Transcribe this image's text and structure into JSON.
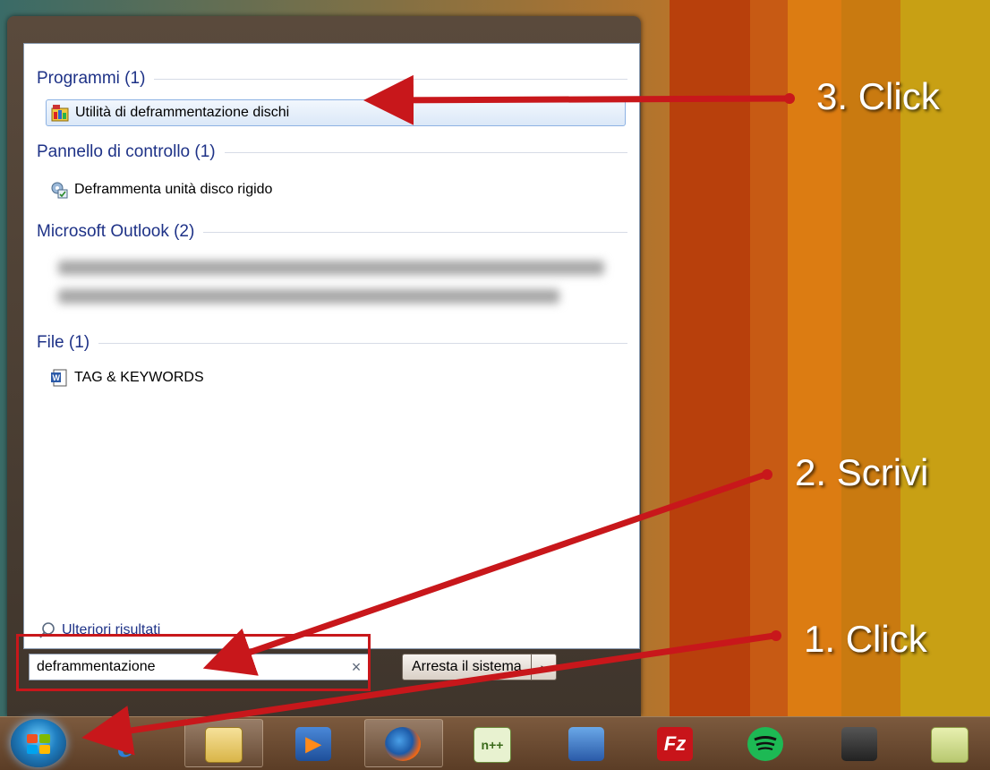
{
  "start_menu": {
    "groups": [
      {
        "title": "Programmi (1)",
        "items": [
          {
            "label": "Utilità di deframmentazione dischi",
            "icon": "defrag-icon"
          }
        ]
      },
      {
        "title": "Pannello di controllo (1)",
        "items": [
          {
            "label": "Deframmenta unità disco rigido",
            "icon": "control-panel-icon"
          }
        ]
      },
      {
        "title": "Microsoft Outlook (2)",
        "items": []
      },
      {
        "title": "File (1)",
        "items": [
          {
            "label": "TAG & KEYWORDS",
            "icon": "word-document-icon"
          }
        ]
      }
    ],
    "more_results": "Ulteriori risultati",
    "search": {
      "value": "deframmentazione",
      "clear": "×"
    },
    "shutdown": {
      "label": "Arresta il sistema",
      "arrow": "▸"
    }
  },
  "annotations": {
    "step1": "1. Click",
    "step2": "2. Scrivi",
    "step3": "3. Click"
  },
  "colors": {
    "group_title": "#1e3287",
    "annotation_red": "#c8171b",
    "selection_border": "#8db2e3"
  },
  "taskbar": {
    "icons": [
      "start-orb",
      "internet-explorer-icon",
      "windows-explorer-icon",
      "media-player-icon",
      "firefox-icon",
      "notepad-plus-icon",
      "books-icon",
      "filezilla-icon",
      "spotify-icon",
      "camcorder-icon",
      "sticky-notes-icon"
    ],
    "filezilla_text": "Fz"
  }
}
